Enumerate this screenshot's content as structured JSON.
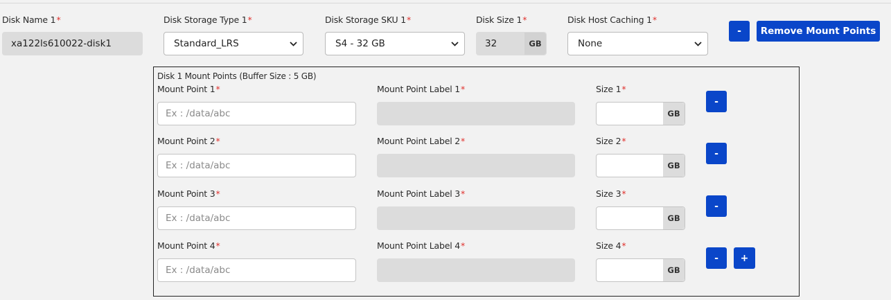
{
  "disk": {
    "name_label": "Disk Name 1",
    "name_value": "xa122ls610022-disk1",
    "storage_type_label": "Disk Storage Type 1",
    "storage_type_value": "Standard_LRS",
    "sku_label": "Disk Storage SKU 1",
    "sku_value": "S4 - 32 GB",
    "size_label": "Disk Size 1",
    "size_value": "32",
    "size_unit": "GB",
    "caching_label": "Disk Host Caching 1",
    "caching_value": "None",
    "remove_disk_label": "-",
    "remove_mount_points_label": "Remove Mount Points",
    "required_mark": "*"
  },
  "mount_points": {
    "header": "Disk 1 Mount Points (Buffer Size : 5 GB)",
    "unit": "GB",
    "placeholder": "Ex : /data/abc",
    "remove_label": "-",
    "add_label": "+",
    "rows": [
      {
        "mp_label": "Mount Point 1",
        "mpl_label": "Mount Point Label 1",
        "size_label": "Size 1"
      },
      {
        "mp_label": "Mount Point 2",
        "mpl_label": "Mount Point Label 2",
        "size_label": "Size 2"
      },
      {
        "mp_label": "Mount Point 3",
        "mpl_label": "Mount Point Label 3",
        "size_label": "Size 3"
      },
      {
        "mp_label": "Mount Point 4",
        "mpl_label": "Mount Point Label 4",
        "size_label": "Size 4"
      }
    ]
  }
}
